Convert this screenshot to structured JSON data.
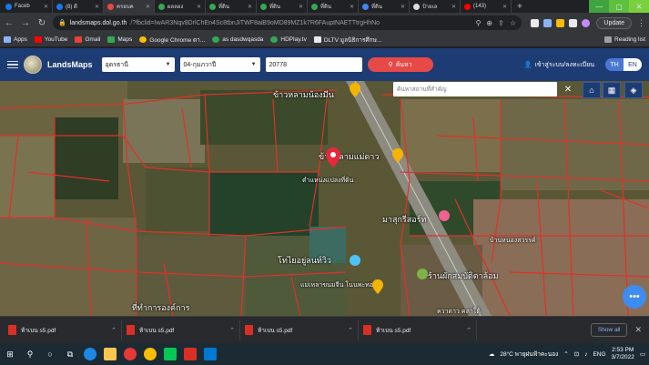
{
  "browser": {
    "tabs": [
      {
        "title": "Faceb",
        "color": "#1877f2"
      },
      {
        "title": "(8) ดี",
        "color": "#1877f2"
      },
      {
        "title": "ครอบค",
        "color": "#e64946"
      },
      {
        "title": "ผลลอง",
        "color": "#34a853"
      },
      {
        "title": "ที่ดิน",
        "color": "#34a853"
      },
      {
        "title": "ที่ดิน",
        "color": "#34a853"
      },
      {
        "title": "ที่ดิน",
        "color": "#34a853"
      },
      {
        "title": "ที่ดิน",
        "color": "#4285f4"
      },
      {
        "title": "ป้ายเล",
        "color": "#dadce0"
      },
      {
        "title": "(143)",
        "color": "#ff0000"
      }
    ],
    "url_host": "landsmaps.dol.go.th",
    "url_path": "/?fbclid=IwAR3Nqv8DrlChEn4Sc8tbnJiTWF8aiB9oMD89MZ1k7R6FAuptNAETTtrgHhNo",
    "update_label": "Update",
    "bookmarks": [
      {
        "label": "Apps",
        "color": "#8ab4f8"
      },
      {
        "label": "YouTube",
        "color": "#ff0000"
      },
      {
        "label": "Gmail",
        "color": "#ea4335"
      },
      {
        "label": "Maps",
        "color": "#34a853"
      },
      {
        "label": "Google Chrome ดา...",
        "color": "#fbbc04"
      },
      {
        "label": "as dasdwqasda",
        "color": "#34a853"
      },
      {
        "label": "HDPlay.tv",
        "color": "#34a853"
      },
      {
        "label": "DLTV มูลนิธิการศึกษ...",
        "color": "#e8eaed"
      }
    ],
    "reading_list": "Reading list"
  },
  "site": {
    "logo": "LandsMaps",
    "province": "อุดรธานี",
    "district": "04-กุมภวาปี",
    "parcel_no": "20778",
    "search_label": "ค้นหา",
    "login_label": "เข้าสู่ระบบ/ลงทะเบียน",
    "lang_th": "TH",
    "lang_en": "EN"
  },
  "map": {
    "place_search_placeholder": "ค้นหาสถานที่สำคัญ",
    "labels": [
      {
        "text": "ข้าวหลามน้องมีน",
        "cls": ""
      },
      {
        "text": "ข้าวหลามแม่ดาว",
        "cls": ""
      },
      {
        "text": "ตำแหน่งแปลงที่ดิน",
        "cls": "small"
      },
      {
        "text": "มาสุกรีสอร์ท",
        "cls": ""
      },
      {
        "text": "บ้านหนองสวรรค์",
        "cls": ""
      },
      {
        "text": "โทไยอยู่ลนท์วิว",
        "cls": ""
      },
      {
        "text": "ร้านผักสมบัติตาล้อม",
        "cls": ""
      },
      {
        "text": "แม่เหลาขนมจีน โนนพะทอ",
        "cls": ""
      },
      {
        "text": "ที่ทำการองค์การ",
        "cls": ""
      },
      {
        "text": "ควาดาว คลาใต้",
        "cls": ""
      }
    ]
  },
  "downloads": [
    {
      "name": "ห้าเบน s5.pdf"
    },
    {
      "name": "ห้าเบน s5.pdf"
    },
    {
      "name": "ห้าเบน s5.pdf"
    },
    {
      "name": "ห้าเบน s5.pdf"
    }
  ],
  "show_all": "Show all",
  "taskbar": {
    "weather": "28°C พายุฝนฟ้าคะนอง",
    "lang": "ENG",
    "time": "2:53 PM",
    "date": "3/7/2022"
  },
  "icons": [
    "menu-icon",
    "search-icon",
    "home-icon",
    "grid-icon",
    "layers-icon",
    "pin-icon",
    "close-icon",
    "download-icon",
    "windows-icon"
  ]
}
